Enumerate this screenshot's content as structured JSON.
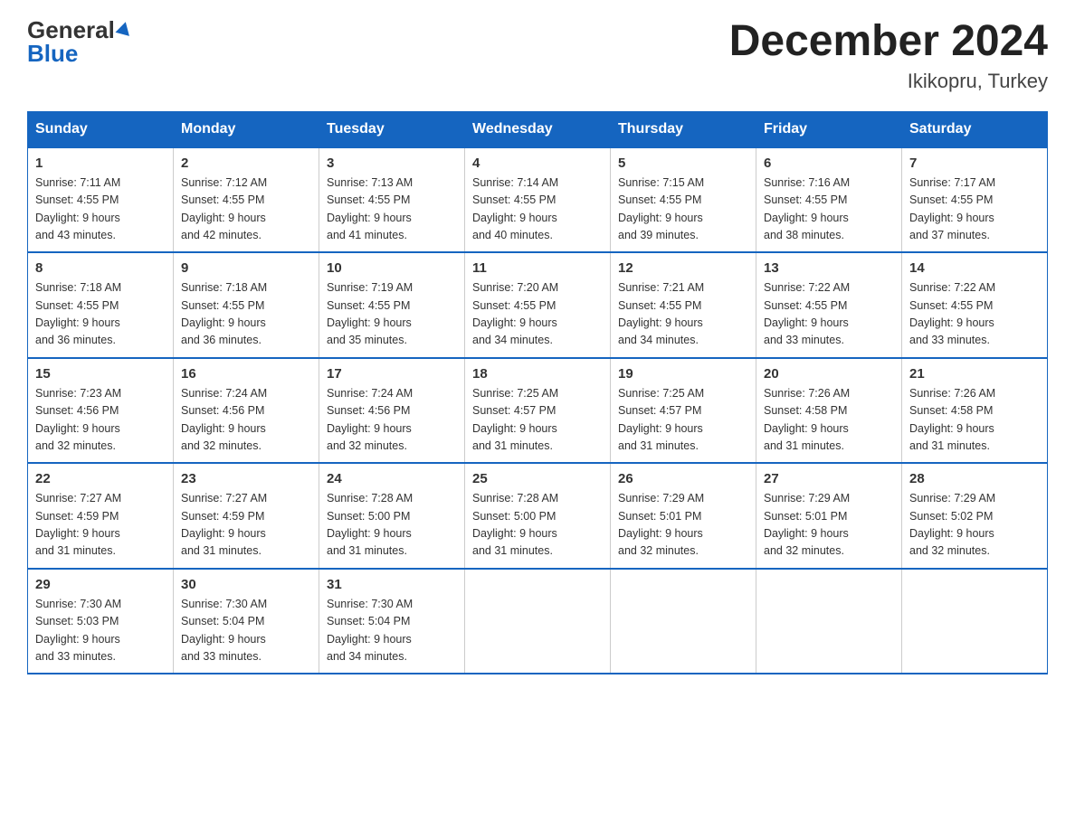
{
  "header": {
    "logo_general": "General",
    "logo_blue": "Blue",
    "title": "December 2024",
    "location": "Ikikopru, Turkey"
  },
  "days_of_week": [
    "Sunday",
    "Monday",
    "Tuesday",
    "Wednesday",
    "Thursday",
    "Friday",
    "Saturday"
  ],
  "weeks": [
    [
      {
        "day": "1",
        "sunrise": "7:11 AM",
        "sunset": "4:55 PM",
        "daylight": "9 hours and 43 minutes."
      },
      {
        "day": "2",
        "sunrise": "7:12 AM",
        "sunset": "4:55 PM",
        "daylight": "9 hours and 42 minutes."
      },
      {
        "day": "3",
        "sunrise": "7:13 AM",
        "sunset": "4:55 PM",
        "daylight": "9 hours and 41 minutes."
      },
      {
        "day": "4",
        "sunrise": "7:14 AM",
        "sunset": "4:55 PM",
        "daylight": "9 hours and 40 minutes."
      },
      {
        "day": "5",
        "sunrise": "7:15 AM",
        "sunset": "4:55 PM",
        "daylight": "9 hours and 39 minutes."
      },
      {
        "day": "6",
        "sunrise": "7:16 AM",
        "sunset": "4:55 PM",
        "daylight": "9 hours and 38 minutes."
      },
      {
        "day": "7",
        "sunrise": "7:17 AM",
        "sunset": "4:55 PM",
        "daylight": "9 hours and 37 minutes."
      }
    ],
    [
      {
        "day": "8",
        "sunrise": "7:18 AM",
        "sunset": "4:55 PM",
        "daylight": "9 hours and 36 minutes."
      },
      {
        "day": "9",
        "sunrise": "7:18 AM",
        "sunset": "4:55 PM",
        "daylight": "9 hours and 36 minutes."
      },
      {
        "day": "10",
        "sunrise": "7:19 AM",
        "sunset": "4:55 PM",
        "daylight": "9 hours and 35 minutes."
      },
      {
        "day": "11",
        "sunrise": "7:20 AM",
        "sunset": "4:55 PM",
        "daylight": "9 hours and 34 minutes."
      },
      {
        "day": "12",
        "sunrise": "7:21 AM",
        "sunset": "4:55 PM",
        "daylight": "9 hours and 34 minutes."
      },
      {
        "day": "13",
        "sunrise": "7:22 AM",
        "sunset": "4:55 PM",
        "daylight": "9 hours and 33 minutes."
      },
      {
        "day": "14",
        "sunrise": "7:22 AM",
        "sunset": "4:55 PM",
        "daylight": "9 hours and 33 minutes."
      }
    ],
    [
      {
        "day": "15",
        "sunrise": "7:23 AM",
        "sunset": "4:56 PM",
        "daylight": "9 hours and 32 minutes."
      },
      {
        "day": "16",
        "sunrise": "7:24 AM",
        "sunset": "4:56 PM",
        "daylight": "9 hours and 32 minutes."
      },
      {
        "day": "17",
        "sunrise": "7:24 AM",
        "sunset": "4:56 PM",
        "daylight": "9 hours and 32 minutes."
      },
      {
        "day": "18",
        "sunrise": "7:25 AM",
        "sunset": "4:57 PM",
        "daylight": "9 hours and 31 minutes."
      },
      {
        "day": "19",
        "sunrise": "7:25 AM",
        "sunset": "4:57 PM",
        "daylight": "9 hours and 31 minutes."
      },
      {
        "day": "20",
        "sunrise": "7:26 AM",
        "sunset": "4:58 PM",
        "daylight": "9 hours and 31 minutes."
      },
      {
        "day": "21",
        "sunrise": "7:26 AM",
        "sunset": "4:58 PM",
        "daylight": "9 hours and 31 minutes."
      }
    ],
    [
      {
        "day": "22",
        "sunrise": "7:27 AM",
        "sunset": "4:59 PM",
        "daylight": "9 hours and 31 minutes."
      },
      {
        "day": "23",
        "sunrise": "7:27 AM",
        "sunset": "4:59 PM",
        "daylight": "9 hours and 31 minutes."
      },
      {
        "day": "24",
        "sunrise": "7:28 AM",
        "sunset": "5:00 PM",
        "daylight": "9 hours and 31 minutes."
      },
      {
        "day": "25",
        "sunrise": "7:28 AM",
        "sunset": "5:00 PM",
        "daylight": "9 hours and 31 minutes."
      },
      {
        "day": "26",
        "sunrise": "7:29 AM",
        "sunset": "5:01 PM",
        "daylight": "9 hours and 32 minutes."
      },
      {
        "day": "27",
        "sunrise": "7:29 AM",
        "sunset": "5:01 PM",
        "daylight": "9 hours and 32 minutes."
      },
      {
        "day": "28",
        "sunrise": "7:29 AM",
        "sunset": "5:02 PM",
        "daylight": "9 hours and 32 minutes."
      }
    ],
    [
      {
        "day": "29",
        "sunrise": "7:30 AM",
        "sunset": "5:03 PM",
        "daylight": "9 hours and 33 minutes."
      },
      {
        "day": "30",
        "sunrise": "7:30 AM",
        "sunset": "5:04 PM",
        "daylight": "9 hours and 33 minutes."
      },
      {
        "day": "31",
        "sunrise": "7:30 AM",
        "sunset": "5:04 PM",
        "daylight": "9 hours and 34 minutes."
      },
      null,
      null,
      null,
      null
    ]
  ],
  "labels": {
    "sunrise": "Sunrise:",
    "sunset": "Sunset:",
    "daylight": "Daylight:"
  }
}
